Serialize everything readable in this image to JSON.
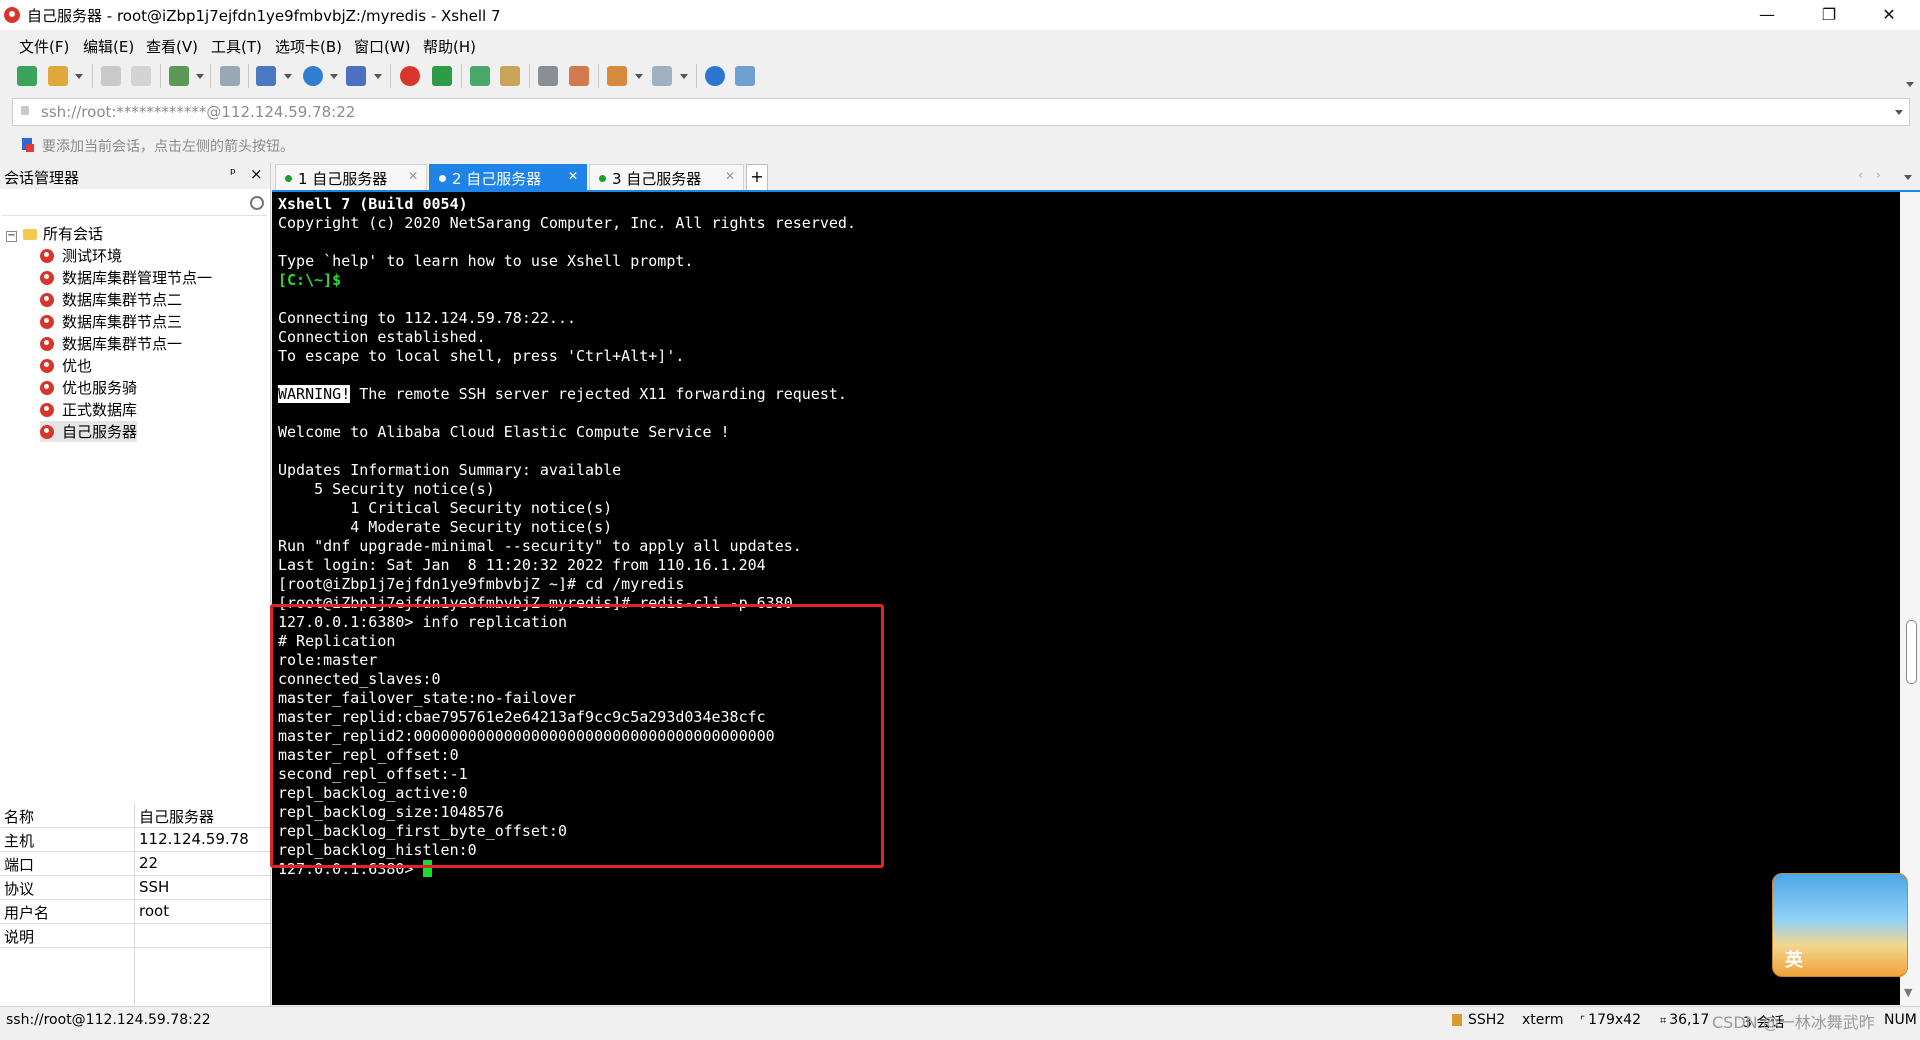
{
  "window": {
    "title": "自己服务器 - root@iZbp1j7ejfdn1ye9fmbvbjZ:/myredis - Xshell 7",
    "minimize": "—",
    "maximize": "❐",
    "close": "✕"
  },
  "menu": [
    "文件(F)",
    "编辑(E)",
    "查看(V)",
    "工具(T)",
    "选项卡(B)",
    "窗口(W)",
    "帮助(H)"
  ],
  "address": {
    "value": "ssh://root:************@112.124.59.78:22"
  },
  "hint": "要添加当前会话，点击左侧的箭头按钮。",
  "session_manager": {
    "title": "会话管理器",
    "pin": "ᵖ",
    "close": "×",
    "root": "所有会话",
    "items": [
      "测试环境",
      "数据库集群管理节点一",
      "数据库集群节点二",
      "数据库集群节点三",
      "数据库集群节点一",
      "优也",
      "优也服务骑",
      "正式数据库",
      "自己服务器"
    ]
  },
  "properties": [
    {
      "key": "名称",
      "value": "自己服务器"
    },
    {
      "key": "主机",
      "value": "112.124.59.78"
    },
    {
      "key": "端口",
      "value": "22"
    },
    {
      "key": "协议",
      "value": "SSH"
    },
    {
      "key": "用户名",
      "value": "root"
    },
    {
      "key": "说明",
      "value": ""
    }
  ],
  "tabs": [
    {
      "label": "1 自己服务器",
      "active": false
    },
    {
      "label": "2 自己服务器",
      "active": true
    },
    {
      "label": "3 自己服务器",
      "active": false
    }
  ],
  "tab_add": "+",
  "terminal": {
    "lines": [
      {
        "text": "Xshell 7 (Build 0054)",
        "style": "bold"
      },
      {
        "text": "Copyright (c) 2020 NetSarang Computer, Inc. All rights reserved.",
        "style": ""
      },
      {
        "text": "",
        "style": ""
      },
      {
        "text": "Type `help' to learn how to use Xshell prompt.",
        "style": ""
      },
      {
        "text": "[C:\\~]$",
        "style": "green"
      },
      {
        "text": "",
        "style": ""
      },
      {
        "text": "Connecting to 112.124.59.78:22...",
        "style": ""
      },
      {
        "text": "Connection established.",
        "style": ""
      },
      {
        "text": "To escape to local shell, press 'Ctrl+Alt+]'.",
        "style": ""
      },
      {
        "text": "",
        "style": ""
      },
      {
        "text": " The remote SSH server rejected X11 forwarding request.",
        "style": "warn"
      },
      {
        "text": "",
        "style": ""
      },
      {
        "text": "Welcome to Alibaba Cloud Elastic Compute Service !",
        "style": ""
      },
      {
        "text": "",
        "style": ""
      },
      {
        "text": "Updates Information Summary: available",
        "style": ""
      },
      {
        "text": "    5 Security notice(s)",
        "style": ""
      },
      {
        "text": "        1 Critical Security notice(s)",
        "style": ""
      },
      {
        "text": "        4 Moderate Security notice(s)",
        "style": ""
      },
      {
        "text": "Run \"dnf upgrade-minimal --security\" to apply all updates.",
        "style": ""
      },
      {
        "text": "Last login: Sat Jan  8 11:20:32 2022 from 110.16.1.204",
        "style": ""
      },
      {
        "text": "[root@iZbp1j7ejfdn1ye9fmbvbjZ ~]# cd /myredis",
        "style": ""
      },
      {
        "text": "[root@iZbp1j7ejfdn1ye9fmbvbjZ myredis]# redis-cli -p 6380",
        "style": ""
      },
      {
        "text": "127.0.0.1:6380> info replication",
        "style": ""
      },
      {
        "text": "# Replication",
        "style": ""
      },
      {
        "text": "role:master",
        "style": ""
      },
      {
        "text": "connected_slaves:0",
        "style": ""
      },
      {
        "text": "master_failover_state:no-failover",
        "style": ""
      },
      {
        "text": "master_replid:cbae795761e2e64213af9cc9c5a293d034e38cfc",
        "style": ""
      },
      {
        "text": "master_replid2:0000000000000000000000000000000000000000",
        "style": ""
      },
      {
        "text": "master_repl_offset:0",
        "style": ""
      },
      {
        "text": "second_repl_offset:-1",
        "style": ""
      },
      {
        "text": "repl_backlog_active:0",
        "style": ""
      },
      {
        "text": "repl_backlog_size:1048576",
        "style": ""
      },
      {
        "text": "repl_backlog_first_byte_offset:0",
        "style": ""
      },
      {
        "text": "repl_backlog_histlen:0",
        "style": ""
      },
      {
        "text": "127.0.0.1:6380> ",
        "style": ""
      }
    ],
    "warning_label": "WARNING!"
  },
  "ime": {
    "label": "英"
  },
  "status_bar": {
    "connection": "ssh://root@112.124.59.78:22",
    "protocol": "SSH2",
    "terminal_type": "xterm",
    "size": "179x42",
    "cursor_pos": "36,17",
    "sessions": "3 会话",
    "num": "NUM",
    "watermark": "CSDN @一林冰舞武昨"
  },
  "colors": {
    "accent": "#1f84e8",
    "terminal_bg": "#000000",
    "terminal_green": "#2bd836",
    "highlight_box": "#e32424"
  }
}
